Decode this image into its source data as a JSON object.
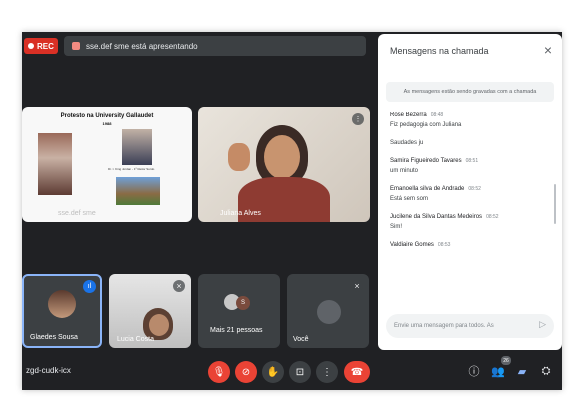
{
  "topbar": {
    "rec_label": "REC",
    "presenting_text": "sse.def sme está apresentando"
  },
  "tiles": {
    "slide": {
      "title": "Protesto na University Gallaudet",
      "subtitle_line": "1988",
      "body_text": "Dr. I. King Jordan - 1º Reitor Surdo",
      "presenter_label": "sse.def sme"
    },
    "juliana": {
      "name": "Juliana Alves"
    },
    "glaedes": {
      "name": "Glaedes Sousa"
    },
    "lucia": {
      "name": "Lucia Costa"
    },
    "mais": {
      "name": "Mais 21 pessoas",
      "avatar_letter": "S"
    },
    "voce": {
      "name": "Você"
    }
  },
  "bottombar": {
    "meeting_code": "zgd-cudk-icx",
    "participants_count": "26"
  },
  "chat": {
    "title": "Mensagens na chamada",
    "notice": "As mensagens estão sendo gravadas com a chamada",
    "messages": [
      {
        "author": "Rose Bezerra",
        "time": "08:48",
        "lines": [
          "Fiz pedagogia com Juliana",
          "Saudades ju"
        ]
      },
      {
        "author": "Samira Figueiredo Tavares",
        "time": "08:51",
        "lines": [
          "um minuto"
        ]
      },
      {
        "author": "Emanoella silva de Andrade",
        "time": "08:52",
        "lines": [
          "Está sem som"
        ]
      },
      {
        "author": "Jucilene da Silva Dantas Medeiros",
        "time": "08:52",
        "lines": [
          "Sim!"
        ]
      },
      {
        "author": "Valdiaire Gomes",
        "time": "08:53",
        "lines": []
      }
    ],
    "input_placeholder": "Envie uma mensagem para todos. As"
  },
  "colors": {
    "meet_background": "#202124",
    "tile_background": "#3c4043",
    "danger": "#ea4335",
    "accent": "#1a73e8"
  },
  "icons": {
    "mic": "mic-off-icon",
    "camera": "camera-off-icon",
    "hand": "raise-hand-icon",
    "present": "present-screen-icon",
    "more": "more-options-icon",
    "hangup": "hangup-icon",
    "info": "info-icon",
    "people": "people-icon",
    "chat": "chat-icon",
    "activities": "activities-icon"
  }
}
